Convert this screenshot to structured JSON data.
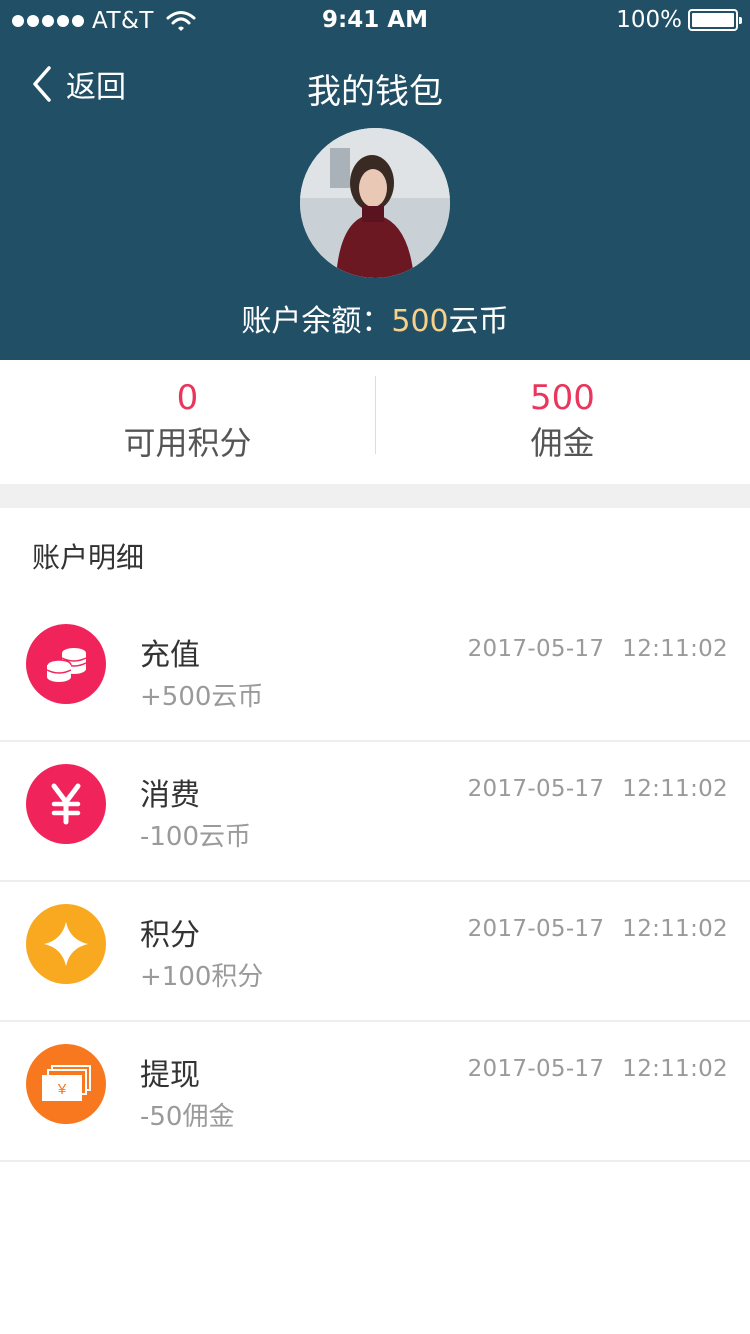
{
  "status_bar": {
    "carrier": "AT&T",
    "time": "9:41 AM",
    "battery": "100%"
  },
  "nav": {
    "back_label": "返回",
    "title": "我的钱包"
  },
  "balance": {
    "label": "账户余额：",
    "amount": "500",
    "unit": "云币"
  },
  "stats": [
    {
      "value": "0",
      "label": "可用积分"
    },
    {
      "value": "500",
      "label": "佣金"
    }
  ],
  "section_title": "账户明细",
  "transactions": [
    {
      "title": "充值",
      "amount": "+500云币",
      "date": "2017-05-17",
      "time": "12:11:02",
      "icon": "coins-icon",
      "color": "#f0245a"
    },
    {
      "title": "消费",
      "amount": "-100云币",
      "date": "2017-05-17",
      "time": "12:11:02",
      "icon": "yen-icon",
      "color": "#f0245a"
    },
    {
      "title": "积分",
      "amount": "+100积分",
      "date": "2017-05-17",
      "time": "12:11:02",
      "icon": "sparkle-icon",
      "color": "#f8a91f"
    },
    {
      "title": "提现",
      "amount": "-50佣金",
      "date": "2017-05-17",
      "time": "12:11:02",
      "icon": "banknotes-icon",
      "color": "#f7781e"
    }
  ],
  "colors": {
    "header_bg": "#214f66",
    "balance_accent": "#f7d08a",
    "stat_value": "#e8365c"
  }
}
